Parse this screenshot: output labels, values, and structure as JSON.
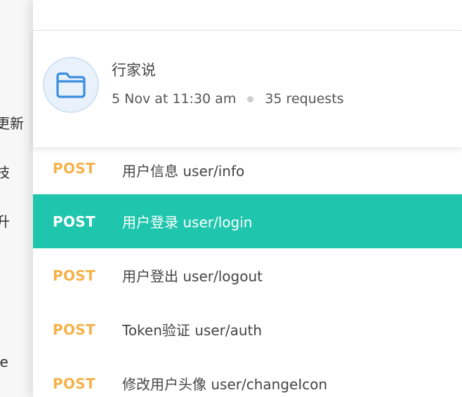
{
  "background_sidebar": {
    "items": [
      {
        "label": "更新"
      },
      {
        "label": "技"
      },
      {
        "label": "升"
      },
      {
        "label": "le"
      }
    ]
  },
  "collection": {
    "icon": "folder-icon",
    "title": "行家说",
    "date": "5 Nov at 11:30 am",
    "requests_count": "35 requests"
  },
  "requests": [
    {
      "method": "POST",
      "name": "用户信息 user/info",
      "active": false
    },
    {
      "method": "POST",
      "name": "用户登录 user/login",
      "active": true
    },
    {
      "method": "POST",
      "name": "用户登出 user/logout",
      "active": false
    },
    {
      "method": "POST",
      "name": "Token验证 user/auth",
      "active": false
    },
    {
      "method": "POST",
      "name": "修改用户头像 user/changeIcon",
      "active": false
    }
  ],
  "colors": {
    "active_row": "#1fc6ad",
    "method_post": "#f5b24a",
    "folder_icon": "#3b8ede"
  }
}
